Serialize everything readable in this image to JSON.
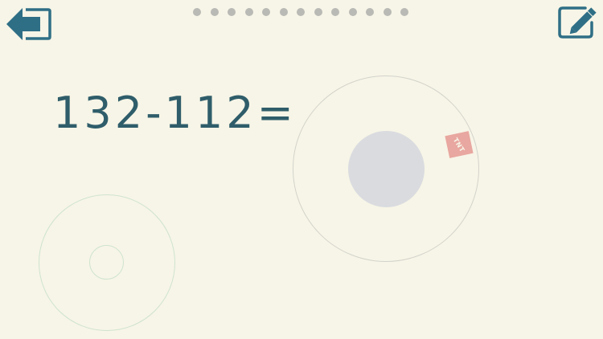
{
  "toolbar": {
    "exit_icon": "exit-arrow-icon",
    "edit_icon": "pencil-edit-icon",
    "accent_color": "#2f6f86"
  },
  "progress": {
    "total_steps": 13
  },
  "question": {
    "equation": "132-112="
  },
  "game": {
    "tnt_label": "TNT",
    "core_color": "#d9dbdf",
    "tnt_color": "#e8a7a0"
  },
  "background_color": "#f7f5e7"
}
